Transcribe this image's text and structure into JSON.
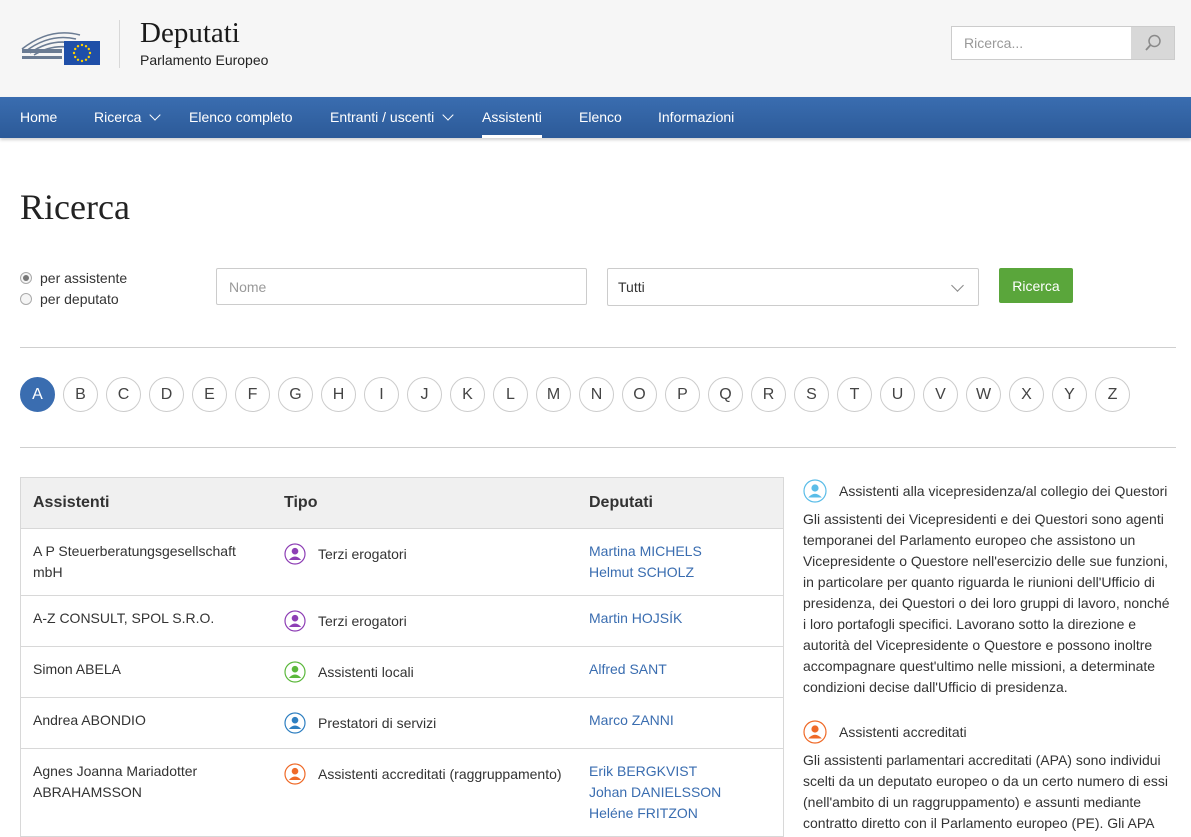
{
  "header": {
    "title": "Deputati",
    "subtitle": "Parlamento Europeo",
    "search_placeholder": "Ricerca..."
  },
  "nav": [
    {
      "label": "Home",
      "dropdown": false,
      "active": false
    },
    {
      "label": "Ricerca",
      "dropdown": true,
      "active": false
    },
    {
      "label": "Elenco completo",
      "dropdown": false,
      "active": false
    },
    {
      "label": "Entranti / uscenti",
      "dropdown": true,
      "active": false
    },
    {
      "label": "Assistenti",
      "dropdown": false,
      "active": true
    },
    {
      "label": "Elenco",
      "dropdown": false,
      "active": false
    },
    {
      "label": "Informazioni",
      "dropdown": false,
      "active": false
    }
  ],
  "page": {
    "title": "Ricerca"
  },
  "search_form": {
    "radio_assistant": "per assistente",
    "radio_mep": "per deputato",
    "selected_radio": "assistant",
    "name_placeholder": "Nome",
    "type_value": "Tutti",
    "submit_label": "Ricerca"
  },
  "letters": [
    "A",
    "B",
    "C",
    "D",
    "E",
    "F",
    "G",
    "H",
    "I",
    "J",
    "K",
    "L",
    "M",
    "N",
    "O",
    "P",
    "Q",
    "R",
    "S",
    "T",
    "U",
    "V",
    "W",
    "X",
    "Y",
    "Z"
  ],
  "active_letter": "A",
  "table": {
    "headers": {
      "assistants": "Assistenti",
      "type": "Tipo",
      "meps": "Deputati"
    },
    "rows": [
      {
        "name": "A P Steuerberatungsgesellschaft mbH",
        "type": "Terzi erogatori",
        "icon": "person-icon-purple",
        "meps": [
          "Martina MICHELS",
          "Helmut SCHOLZ"
        ]
      },
      {
        "name": "A-Z CONSULT, SPOL S.R.O.",
        "type": "Terzi erogatori",
        "icon": "person-icon-purple",
        "meps": [
          "Martin HOJSÍK"
        ]
      },
      {
        "name": "Simon ABELA",
        "type": "Assistenti locali",
        "icon": "person-icon-green",
        "meps": [
          "Alfred SANT"
        ]
      },
      {
        "name": "Andrea ABONDIO",
        "type": "Prestatori di servizi",
        "icon": "person-icon-blue",
        "meps": [
          "Marco ZANNI"
        ]
      },
      {
        "name": "Agnes Joanna Mariadotter ABRAHAMSSON",
        "type": "Assistenti accreditati (raggruppamento)",
        "icon": "person-icon-orange",
        "meps": [
          "Erik BERGKVIST",
          "Johan DANIELSSON",
          "Heléne FRITZON"
        ]
      }
    ]
  },
  "sidebar": [
    {
      "title": "Assistenti alla vicepresidenza/al collegio dei Questori",
      "icon": "person-icon-lightblue",
      "text": "Gli assistenti dei Vicepresidenti e dei Questori sono agenti temporanei del Parlamento europeo che assistono un Vicepresidente o Questore nell'esercizio delle sue funzioni, in particolare per quanto riguarda le riunioni dell'Ufficio di presidenza, dei Questori o dei loro gruppi di lavoro, nonché i loro portafogli specifici. Lavorano sotto la direzione e autorità del Vicepresidente o Questore e possono inoltre accompagnare quest'ultimo nelle missioni, a determinate condizioni decise dall'Ufficio di presidenza."
    },
    {
      "title": "Assistenti accreditati",
      "icon": "person-icon-orange",
      "text": "Gli assistenti parlamentari accreditati (APA) sono individui scelti da un deputato europeo o da un certo numero di essi (nell'ambito di un raggruppamento) e assunti mediante contratto diretto con il Parlamento europeo (PE). Gli APA"
    }
  ],
  "colors": {
    "nav_blue": "#3a6db0",
    "button_green": "#5aa63b",
    "link_blue": "#3a6db0",
    "purple": "#8e3fb5",
    "green": "#5cb83c",
    "blue": "#2e7fc1",
    "orange": "#ef6a28",
    "lightblue": "#5bbde8"
  }
}
